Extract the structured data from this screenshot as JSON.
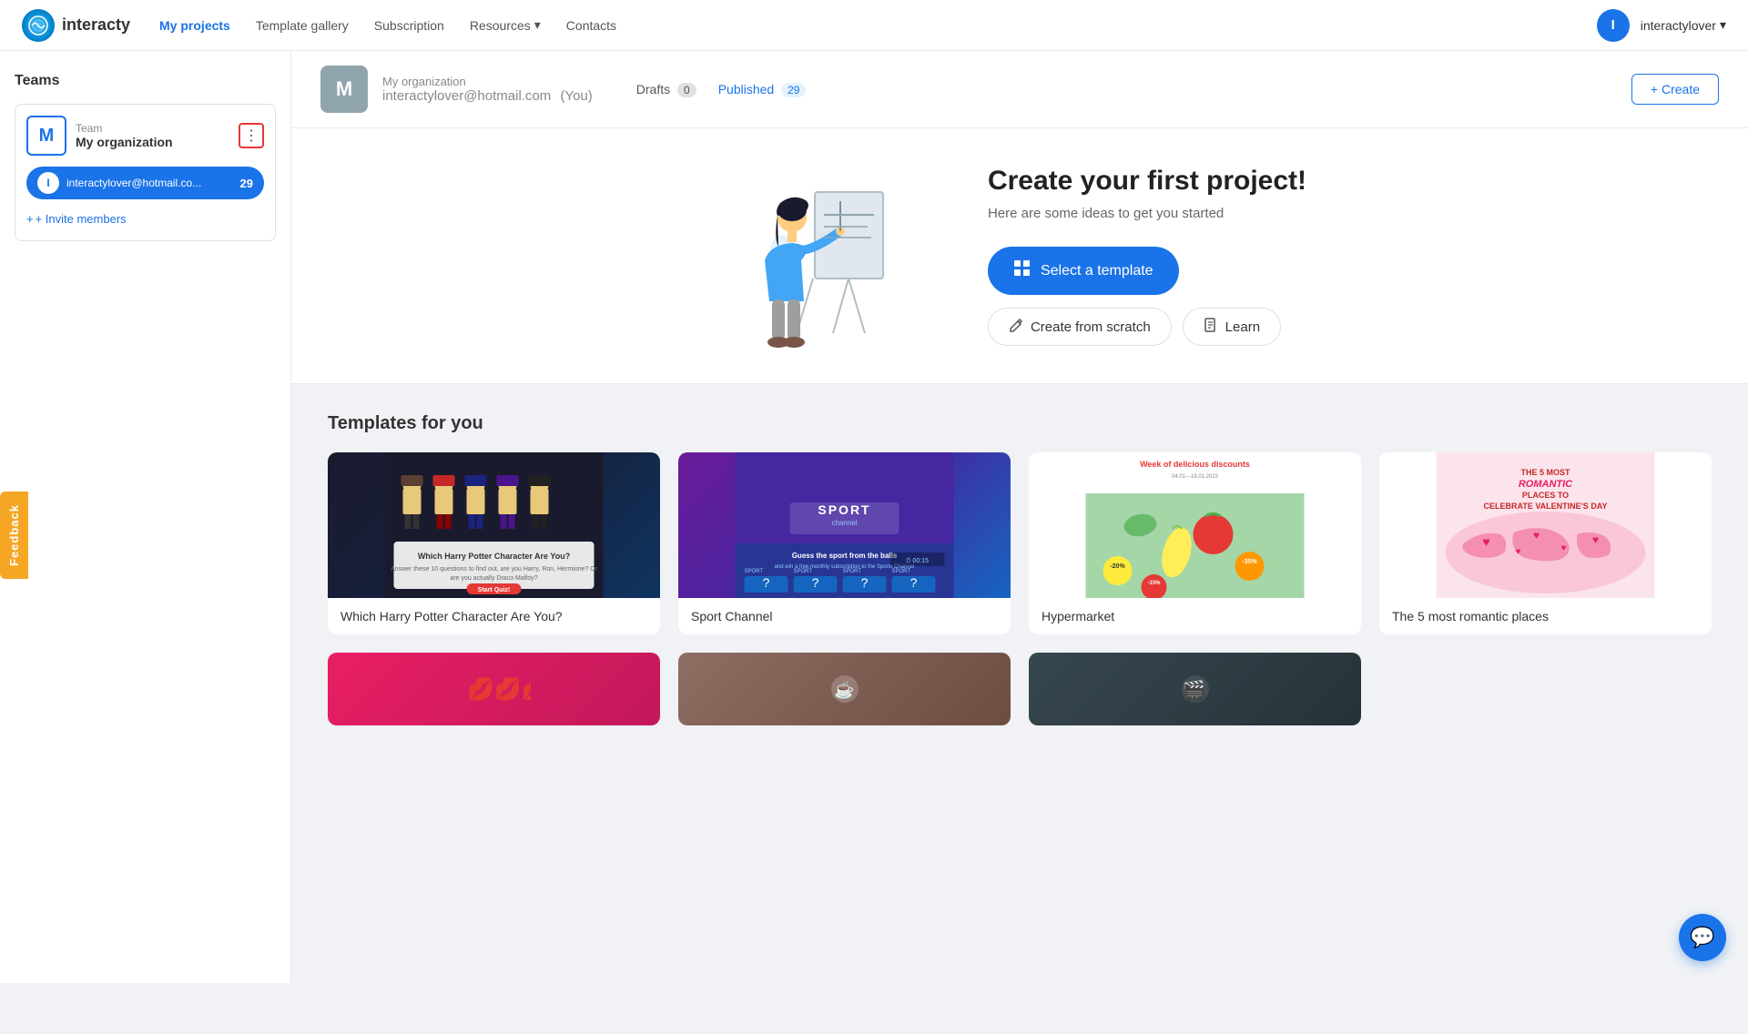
{
  "app": {
    "name": "interacty",
    "logo_letter": "🌐"
  },
  "nav": {
    "items": [
      {
        "label": "My projects",
        "active": true,
        "id": "my-projects"
      },
      {
        "label": "Template gallery",
        "active": false,
        "id": "template-gallery"
      },
      {
        "label": "Subscription",
        "active": false,
        "id": "subscription"
      },
      {
        "label": "Resources",
        "active": false,
        "id": "resources",
        "has_dropdown": true
      },
      {
        "label": "Contacts",
        "active": false,
        "id": "contacts"
      }
    ],
    "user": {
      "name": "interactylover",
      "avatar_letter": "I"
    }
  },
  "sidebar": {
    "teams_label": "Teams",
    "team": {
      "avatar_letter": "M",
      "team_label": "Team",
      "team_name": "My organization"
    },
    "member": {
      "avatar_letter": "I",
      "email": "interactylover@hotmail.co...",
      "count": 29
    },
    "invite_label": "+ Invite members"
  },
  "org_header": {
    "avatar_letter": "M",
    "org_name": "My organization",
    "email": "interactylover@hotmail.com",
    "you_label": "(You)",
    "tabs": [
      {
        "label": "Drafts",
        "count": "0",
        "active": false,
        "id": "drafts"
      },
      {
        "label": "Published",
        "count": "29",
        "active": true,
        "id": "published"
      }
    ],
    "create_btn": "+ Create"
  },
  "hero": {
    "title": "Create your first project!",
    "subtitle": "Here are some ideas to get you started",
    "select_template_label": "Select a template",
    "create_scratch_label": "Create from scratch",
    "learn_label": "Learn"
  },
  "templates_section": {
    "title": "Templates for you",
    "items": [
      {
        "id": "harry-potter",
        "name": "Which Harry Potter Character Are You?",
        "type": "harry-potter"
      },
      {
        "id": "sport-channel",
        "name": "Sport Channel",
        "type": "sport"
      },
      {
        "id": "hypermarket",
        "name": "Hypermarket",
        "type": "hypermarket",
        "tag": "Week of delicious discounts"
      },
      {
        "id": "romantic-places",
        "name": "The 5 most romantic places",
        "type": "romantic"
      }
    ]
  },
  "feedback": {
    "label": "Feedback"
  },
  "chat": {
    "icon": "💬"
  }
}
